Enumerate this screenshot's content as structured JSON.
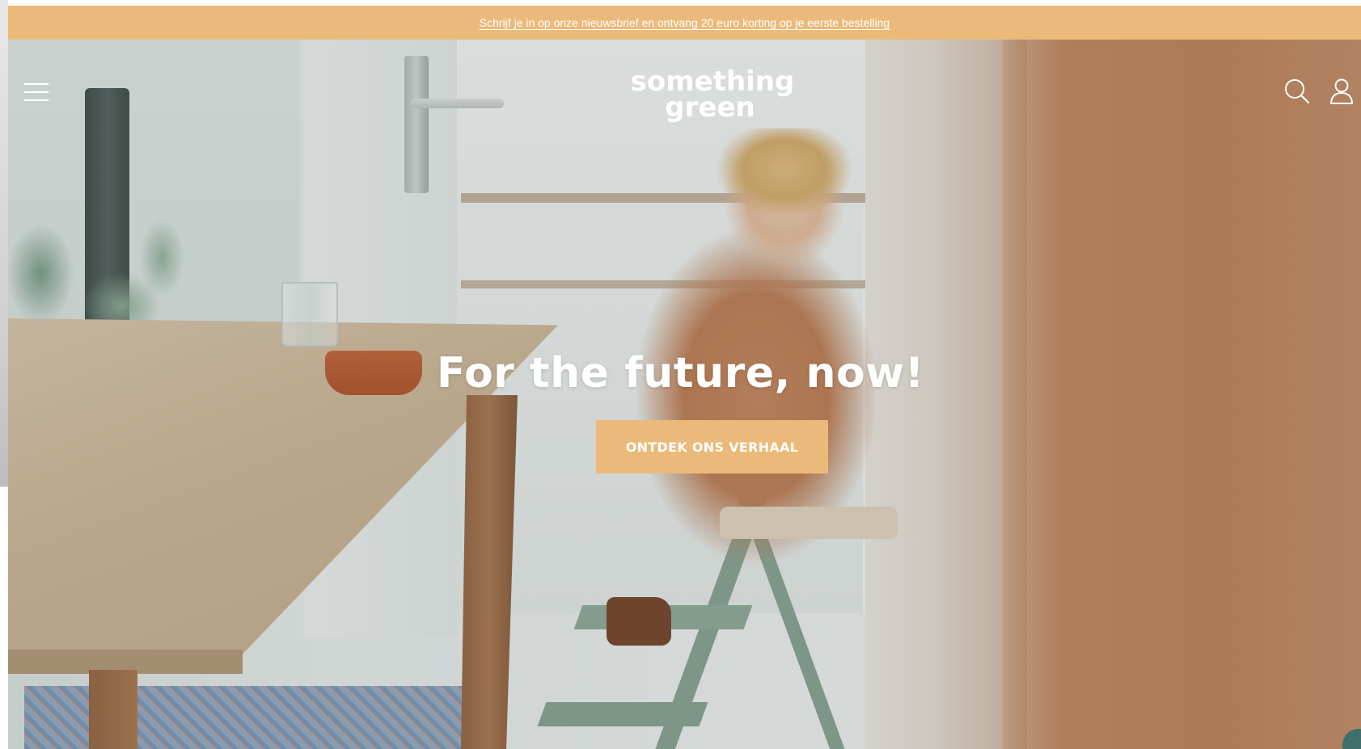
{
  "announcement": {
    "text": "Schrijf je in op onze nieuwsbrief en ontvang 20 euro korting op je eerste bestelling"
  },
  "header": {
    "logo_line1": "something",
    "logo_line2": "green",
    "icons": {
      "menu": "hamburger-menu-icon",
      "search": "search-icon",
      "account": "user-icon"
    }
  },
  "hero": {
    "title": "For the future, now!",
    "cta_label": "ONTDEK ONS VERHAAL"
  },
  "colors": {
    "accent": "#ebba7a",
    "text_on_image": "#ffffff",
    "chat_bubble": "#3e6f6a"
  }
}
